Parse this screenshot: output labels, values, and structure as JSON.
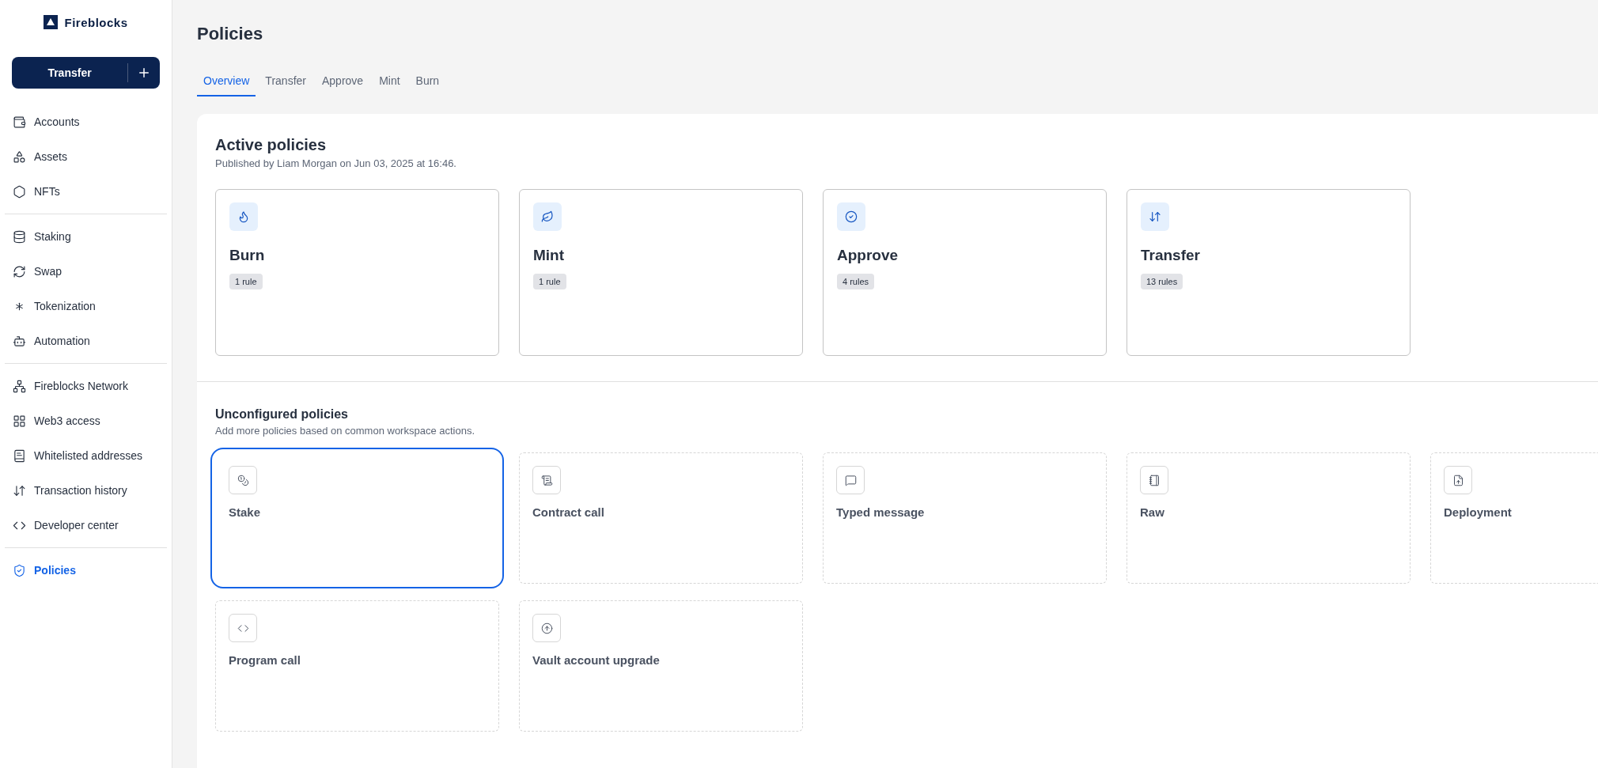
{
  "sidebar": {
    "logo": "Fireblocks",
    "action_button": {
      "label": "Transfer"
    },
    "groups": [
      [
        {
          "label": "Accounts",
          "selected": false
        },
        {
          "label": "Assets",
          "selected": false
        },
        {
          "label": "NFTs",
          "selected": false
        }
      ],
      [
        {
          "label": "Staking",
          "selected": false
        },
        {
          "label": "Swap",
          "selected": false
        },
        {
          "label": "Tokenization",
          "selected": false
        },
        {
          "label": "Automation",
          "selected": false
        }
      ],
      [
        {
          "label": "Fireblocks Network",
          "selected": false
        },
        {
          "label": "Web3 access",
          "selected": false
        },
        {
          "label": "Whitelisted addresses",
          "selected": false
        },
        {
          "label": "Transaction history",
          "selected": false
        },
        {
          "label": "Developer center",
          "selected": false
        }
      ],
      [
        {
          "label": "Policies",
          "selected": true
        }
      ]
    ]
  },
  "page": {
    "title": "Policies",
    "tabs": [
      {
        "label": "Overview",
        "selected": true
      },
      {
        "label": "Transfer",
        "selected": false
      },
      {
        "label": "Approve",
        "selected": false
      },
      {
        "label": "Mint",
        "selected": false
      },
      {
        "label": "Burn",
        "selected": false
      }
    ],
    "active_policies": {
      "title": "Active policies",
      "subtitle": "Published by Liam Morgan on Jun 03, 2025 at 16:46.",
      "cards": [
        {
          "title": "Burn",
          "badge": "1 rule"
        },
        {
          "title": "Mint",
          "badge": "1 rule"
        },
        {
          "title": "Approve",
          "badge": "4 rules"
        },
        {
          "title": "Transfer",
          "badge": "13 rules"
        }
      ]
    },
    "unconfigured_policies": {
      "title": "Unconfigured policies",
      "subtitle": "Add more policies based on common workspace actions.",
      "cards": [
        {
          "title": "Stake",
          "selected": true
        },
        {
          "title": "Contract call",
          "selected": false
        },
        {
          "title": "Typed message",
          "selected": false
        },
        {
          "title": "Raw",
          "selected": false
        },
        {
          "title": "Deployment",
          "selected": false
        },
        {
          "title": "Program call",
          "selected": false
        },
        {
          "title": "Vault account upgrade",
          "selected": false
        }
      ]
    }
  }
}
